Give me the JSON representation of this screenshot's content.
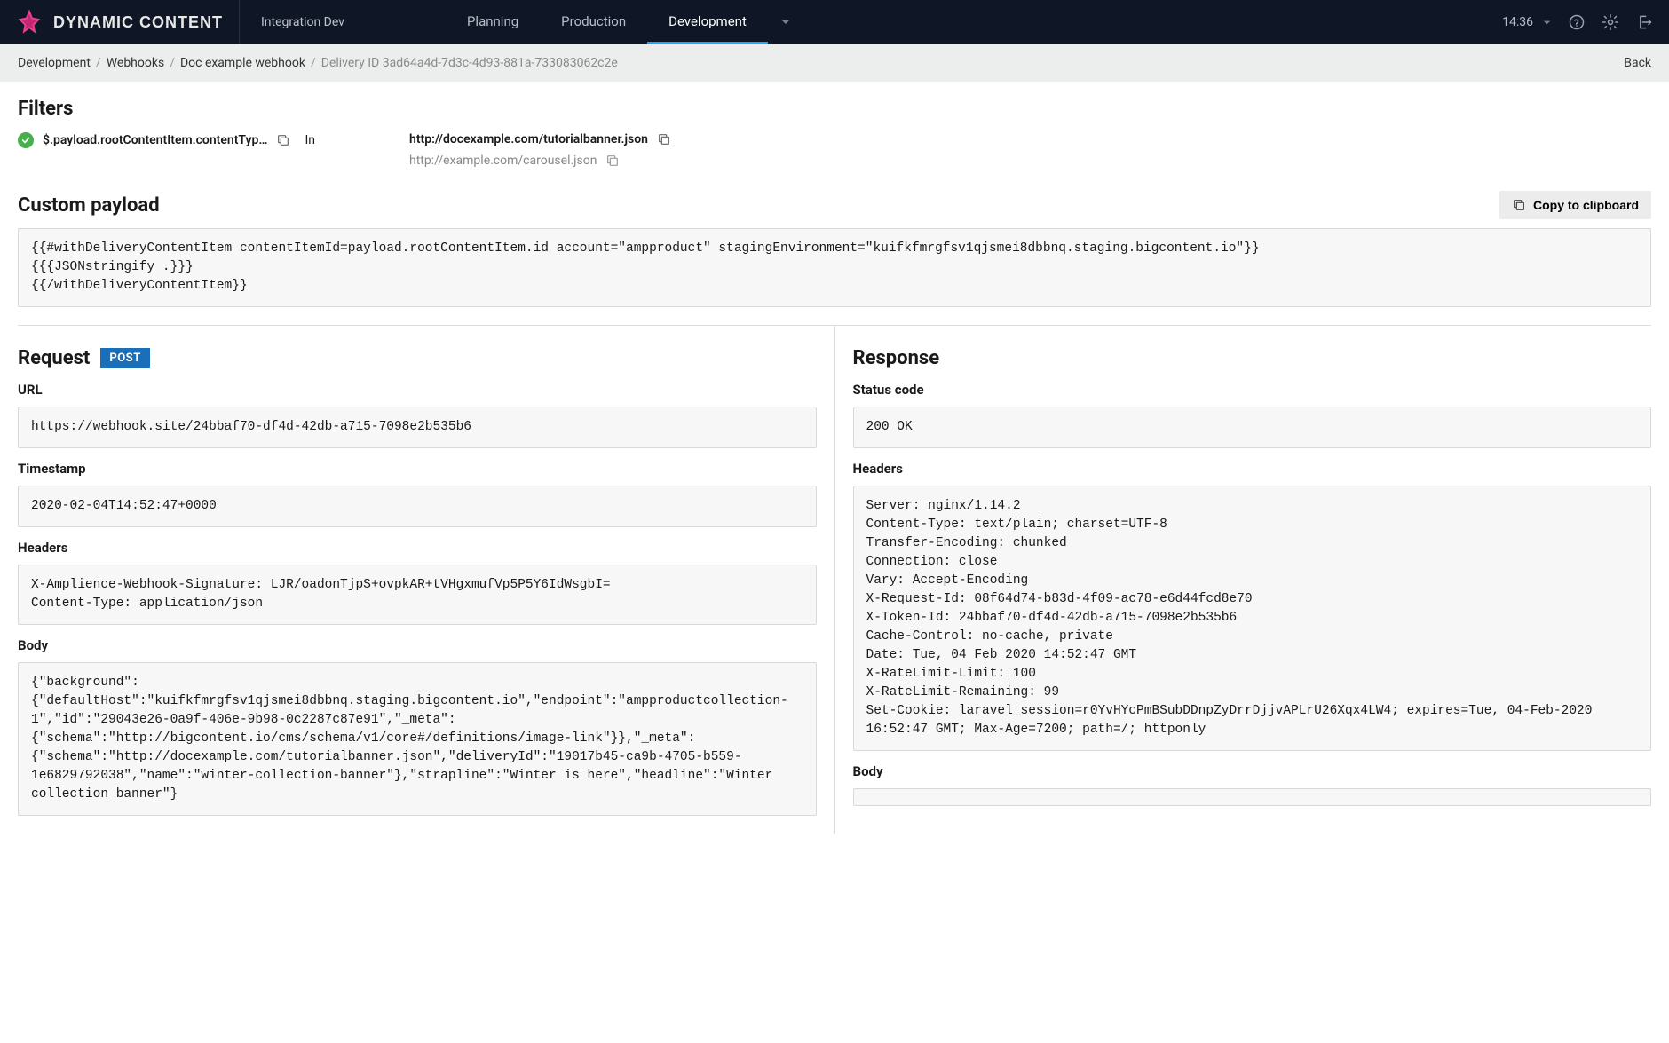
{
  "navbar": {
    "logo_text": "DYNAMIC CONTENT",
    "app_name": "Integration Dev",
    "tabs": [
      {
        "label": "Planning",
        "active": false
      },
      {
        "label": "Production",
        "active": false
      },
      {
        "label": "Development",
        "active": true
      }
    ],
    "time": "14:36"
  },
  "breadcrumb": {
    "items": [
      {
        "label": "Development"
      },
      {
        "label": "Webhooks"
      },
      {
        "label": "Doc example webhook"
      }
    ],
    "current_prefix": "Delivery ID",
    "current_id": "3ad64a4d-7d3c-4d93-881a-733083062c2e",
    "back_label": "Back"
  },
  "sections": {
    "filters_title": "Filters",
    "custom_payload_title": "Custom payload",
    "request_title": "Request",
    "response_title": "Response"
  },
  "filters": {
    "path": "$.payload.rootContentItem.contentTyp…",
    "in_label": "In",
    "urls": [
      {
        "url": "http://docexample.com/tutorialbanner.json",
        "primary": true
      },
      {
        "url": "http://example.com/carousel.json",
        "primary": false
      }
    ]
  },
  "custom_payload": {
    "copy_label": "Copy to clipboard",
    "code": "{{#withDeliveryContentItem contentItemId=payload.rootContentItem.id account=\"ampproduct\" stagingEnvironment=\"kuifkfmrgfsv1qjsmei8dbbnq.staging.bigcontent.io\"}}\n{{{JSONstringify .}}}\n{{/withDeliveryContentItem}}"
  },
  "request": {
    "method": "POST",
    "labels": {
      "url": "URL",
      "timestamp": "Timestamp",
      "headers": "Headers",
      "body": "Body"
    },
    "url": "https://webhook.site/24bbaf70-df4d-42db-a715-7098e2b535b6",
    "timestamp": "2020-02-04T14:52:47+0000",
    "headers": "X-Amplience-Webhook-Signature: LJR/oadonTjpS+ovpkAR+tVHgxmufVp5P5Y6IdWsgbI=\nContent-Type: application/json",
    "body": "{\"background\":{\"defaultHost\":\"kuifkfmrgfsv1qjsmei8dbbnq.staging.bigcontent.io\",\"endpoint\":\"ampproductcollection-1\",\"id\":\"29043e26-0a9f-406e-9b98-0c2287c87e91\",\"_meta\":{\"schema\":\"http://bigcontent.io/cms/schema/v1/core#/definitions/image-link\"}},\"_meta\":{\"schema\":\"http://docexample.com/tutorialbanner.json\",\"deliveryId\":\"19017b45-ca9b-4705-b559-1e6829792038\",\"name\":\"winter-collection-banner\"},\"strapline\":\"Winter is here\",\"headline\":\"Winter collection banner\"}"
  },
  "response": {
    "labels": {
      "status": "Status code",
      "headers": "Headers",
      "body": "Body"
    },
    "status": "200 OK",
    "headers": "Server: nginx/1.14.2\nContent-Type: text/plain; charset=UTF-8\nTransfer-Encoding: chunked\nConnection: close\nVary: Accept-Encoding\nX-Request-Id: 08f64d74-b83d-4f09-ac78-e6d44fcd8e70\nX-Token-Id: 24bbaf70-df4d-42db-a715-7098e2b535b6\nCache-Control: no-cache, private\nDate: Tue, 04 Feb 2020 14:52:47 GMT\nX-RateLimit-Limit: 100\nX-RateLimit-Remaining: 99\nSet-Cookie: laravel_session=r0YvHYcPmBSubDDnpZyDrrDjjvAPLrU26Xqx4LW4; expires=Tue, 04-Feb-2020 16:52:47 GMT; Max-Age=7200; path=/; httponly",
    "body": ""
  }
}
